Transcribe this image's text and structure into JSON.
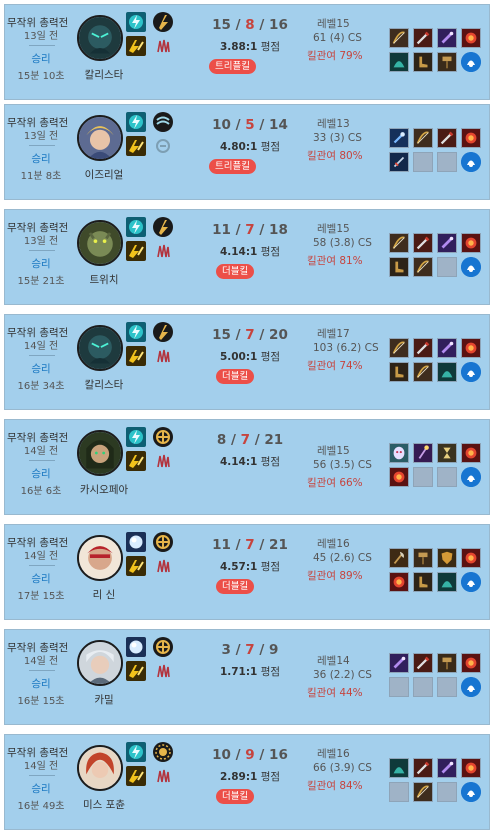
{
  "colors": {
    "card_bg": "#a3cfec",
    "win": "#1a78c2",
    "death": "#c6443e",
    "multikill_badge": "#ec4f48",
    "kill_participation": "#c6443e"
  },
  "matches": [
    {
      "mode": "무작위 총력전",
      "ago": "13일 전",
      "result": "승리",
      "duration": "15분 10초",
      "champion": "칼리스타",
      "kills": "15",
      "deaths": "8",
      "assists": "16",
      "ratio": "3.88:1",
      "ratio_suffix": " 평점",
      "badge": "트리플킬",
      "level": "레벨15",
      "cs": "61 (4) CS",
      "kill_participation": "킬관여 79%",
      "spells": [
        "flash-icon",
        "haste-icon"
      ],
      "runes": [
        "lethal-tempo-icon",
        "precision-icon"
      ],
      "items": [
        "bow-icon",
        "sword-icon",
        "blade-icon",
        "cloak-icon",
        "boots-icon",
        "hammer-icon"
      ],
      "ward": "ward-icon"
    },
    {
      "mode": "무작위 총력전",
      "ago": "13일 전",
      "result": "승리",
      "duration": "11분 8초",
      "champion": "이즈리얼",
      "kills": "10",
      "deaths": "5",
      "assists": "14",
      "ratio": "4.80:1",
      "ratio_suffix": " 평점",
      "badge": "트리플킬",
      "level": "레벨13",
      "cs": "33 (3) CS",
      "kill_participation": "킬관여 80%",
      "spells": [
        "flash-icon",
        "haste-icon"
      ],
      "runes": [
        "wind-rune-icon",
        "inspiration-icon"
      ],
      "items": [
        "wand-icon",
        "bow-icon",
        "sword-icon",
        "dagger-icon",
        "empty",
        "empty"
      ],
      "ward": "ward-icon"
    },
    {
      "mode": "무작위 총력전",
      "ago": "13일 전",
      "result": "승리",
      "duration": "15분 21초",
      "champion": "트위치",
      "kills": "11",
      "deaths": "7",
      "assists": "18",
      "ratio": "4.14:1",
      "ratio_suffix": " 평점",
      "badge": "더블킬",
      "level": "레벨15",
      "cs": "58 (3.8) CS",
      "kill_participation": "킬관여 81%",
      "spells": [
        "flash-icon",
        "haste-icon"
      ],
      "runes": [
        "lethal-tempo-icon",
        "precision-icon"
      ],
      "items": [
        "bow-icon",
        "sword-icon",
        "blade-icon",
        "boots-icon",
        "bow-icon",
        "empty"
      ],
      "ward": "ward-icon"
    },
    {
      "mode": "무작위 총력전",
      "ago": "14일 전",
      "result": "승리",
      "duration": "16분 34초",
      "champion": "칼리스타",
      "kills": "15",
      "deaths": "7",
      "assists": "20",
      "ratio": "5.00:1",
      "ratio_suffix": " 평점",
      "badge": "더블킬",
      "level": "레벨17",
      "cs": "103 (6.2) CS",
      "kill_participation": "킬관여 74%",
      "spells": [
        "flash-icon",
        "haste-icon"
      ],
      "runes": [
        "lethal-tempo-icon",
        "precision-icon"
      ],
      "items": [
        "bow-icon",
        "sword-icon",
        "blade-icon",
        "boots-icon",
        "bow-icon",
        "cloak-icon"
      ],
      "ward": "ward-icon"
    },
    {
      "mode": "무작위 총력전",
      "ago": "14일 전",
      "result": "승리",
      "duration": "16분 6초",
      "champion": "카시오페아",
      "kills": "8",
      "deaths": "7",
      "assists": "21",
      "ratio": "4.14:1",
      "ratio_suffix": " 평점",
      "badge": "",
      "level": "레벨15",
      "cs": "56 (3.5) CS",
      "kill_participation": "킬관여 66%",
      "spells": [
        "flash-icon",
        "haste-icon"
      ],
      "runes": [
        "conqueror-icon",
        "precision-icon"
      ],
      "items": [
        "mask-icon",
        "staff-icon",
        "hourglass-icon",
        "orb-icon",
        "empty",
        "empty"
      ],
      "ward": "ward-icon"
    },
    {
      "mode": "무작위 총력전",
      "ago": "14일 전",
      "result": "승리",
      "duration": "17분 15초",
      "champion": "리 신",
      "kills": "11",
      "deaths": "7",
      "assists": "21",
      "ratio": "4.57:1",
      "ratio_suffix": " 평점",
      "badge": "더블킬",
      "level": "레벨16",
      "cs": "45 (2.6) CS",
      "kill_participation": "킬관여 89%",
      "spells": [
        "snowball-icon",
        "haste-icon"
      ],
      "runes": [
        "conqueror-icon",
        "precision-icon"
      ],
      "items": [
        "axe-icon",
        "hammer-icon",
        "shield-icon",
        "orb-icon",
        "boots-icon",
        "cloak-icon"
      ],
      "ward": "ward-icon"
    },
    {
      "mode": "무작위 총력전",
      "ago": "14일 전",
      "result": "승리",
      "duration": "16분 15초",
      "champion": "카밀",
      "kills": "3",
      "deaths": "7",
      "assists": "9",
      "ratio": "1.71:1",
      "ratio_suffix": " 평점",
      "badge": "",
      "level": "레벨14",
      "cs": "36 (2.2) CS",
      "kill_participation": "킬관여 44%",
      "spells": [
        "snowball-icon",
        "haste-icon"
      ],
      "runes": [
        "conqueror-icon",
        "precision-icon"
      ],
      "items": [
        "blade-icon",
        "sword-icon",
        "hammer-icon",
        "empty",
        "empty",
        "empty"
      ],
      "ward": "ward-icon"
    },
    {
      "mode": "무작위 총력전",
      "ago": "14일 전",
      "result": "승리",
      "duration": "16분 49초",
      "champion": "미스 포츈",
      "kills": "10",
      "deaths": "9",
      "assists": "16",
      "ratio": "2.89:1",
      "ratio_suffix": " 평점",
      "badge": "더블킬",
      "level": "레벨16",
      "cs": "66 (3.9) CS",
      "kill_participation": "킬관여 84%",
      "spells": [
        "flash-icon",
        "haste-icon"
      ],
      "runes": [
        "sun-rune-icon",
        "precision-icon"
      ],
      "items": [
        "cloak-icon",
        "sword-icon",
        "blade-icon",
        "empty",
        "bow-icon",
        "empty"
      ],
      "ward": "ward-icon"
    }
  ]
}
